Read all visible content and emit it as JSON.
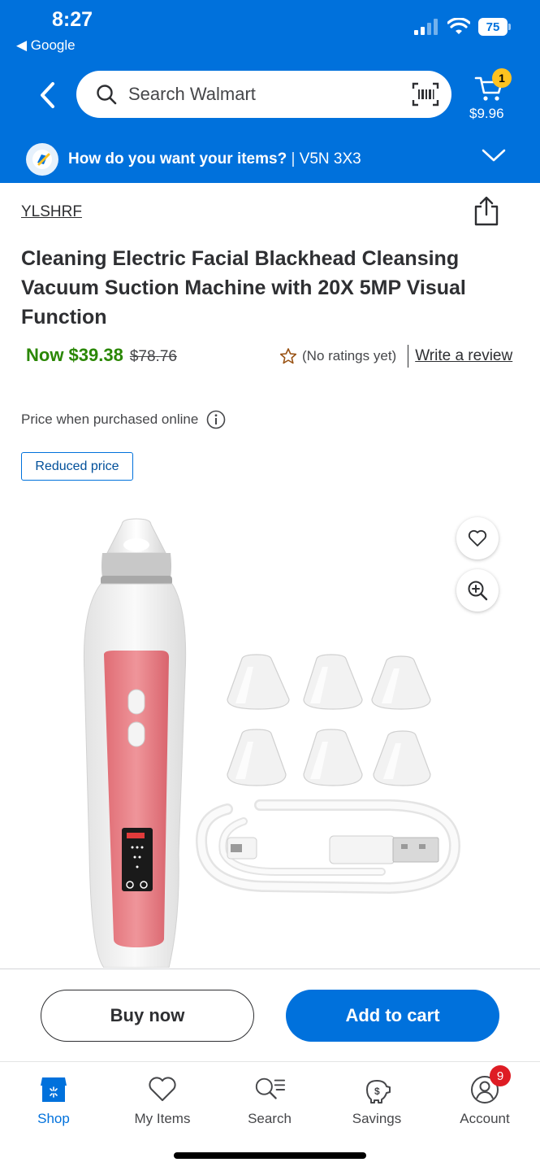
{
  "status_bar": {
    "time": "8:27",
    "back_app": "Google",
    "battery": "75"
  },
  "header": {
    "search_placeholder": "Search Walmart",
    "cart_count": "1",
    "cart_total": "$9.96",
    "delivery_question": "How do you want your items?",
    "delivery_separator": " | ",
    "postal_code": "V5N 3X3",
    "brand_color": "#0071dc"
  },
  "product": {
    "brand": "YLSHRF",
    "title": "Cleaning Electric Facial Blackhead Cleansing Vacuum Suction Machine with 20X 5MP Visual Function",
    "price_now": "Now $39.38",
    "price_was": "$78.76",
    "rating_text": "(No ratings yet)",
    "write_review": "Write a review",
    "online_price_note": "Price when purchased online",
    "badge": "Reduced price"
  },
  "actions": {
    "buy_now": "Buy now",
    "add_to_cart": "Add to cart"
  },
  "tabs": [
    {
      "label": "Shop",
      "icon": "store-icon",
      "active": true
    },
    {
      "label": "My Items",
      "icon": "heart-icon"
    },
    {
      "label": "Search",
      "icon": "search-list-icon"
    },
    {
      "label": "Savings",
      "icon": "savings-icon"
    },
    {
      "label": "Account",
      "icon": "account-icon",
      "badge": "9"
    }
  ]
}
